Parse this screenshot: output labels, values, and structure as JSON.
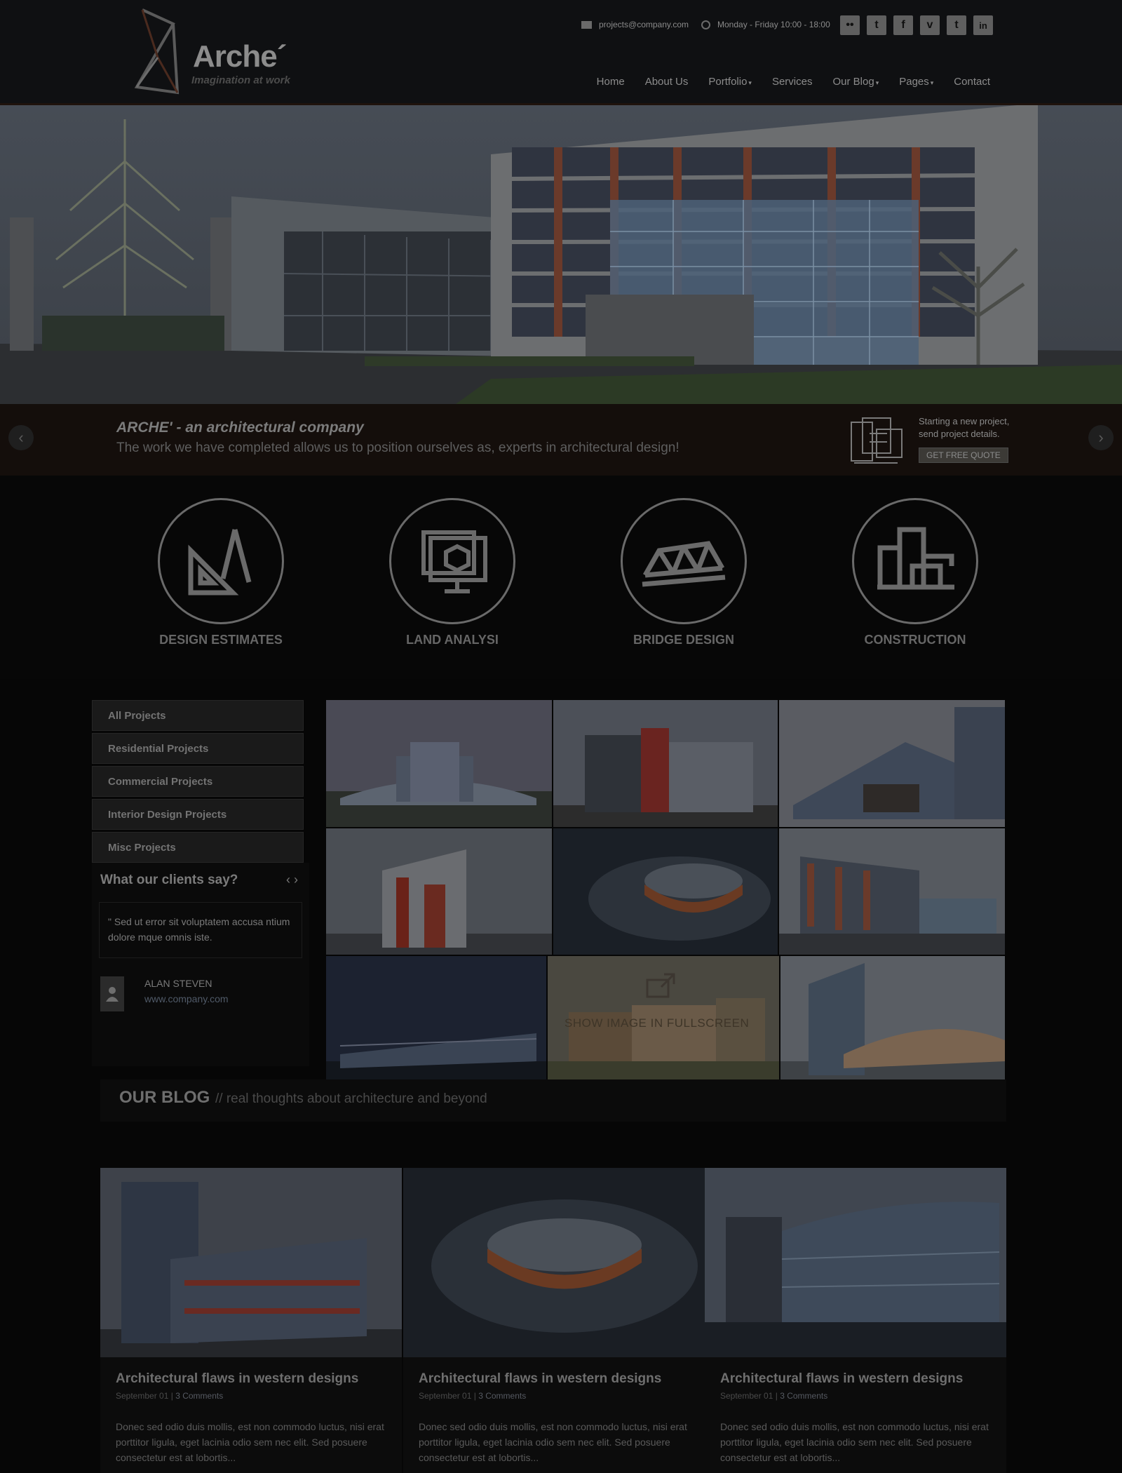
{
  "header": {
    "logo_word": "Arche´",
    "logo_tagline": "Imagination at work",
    "email": "projects@company.com",
    "hours": "Monday - Friday 10:00 - 18:00",
    "social": [
      {
        "icon": "flickr-icon",
        "glyph": "••"
      },
      {
        "icon": "twitter-icon",
        "glyph": "t"
      },
      {
        "icon": "facebook-icon",
        "glyph": "f"
      },
      {
        "icon": "vimeo-icon",
        "glyph": "v"
      },
      {
        "icon": "tumblr-icon",
        "glyph": "t"
      },
      {
        "icon": "linkedin-icon",
        "glyph": "in"
      }
    ],
    "nav": [
      "Home",
      "About Us",
      "Portfolio",
      "Services",
      "Our Blog",
      "Pages",
      "Contact"
    ]
  },
  "banner": {
    "title": "ARCHE' - an architectural company",
    "subtitle": "The work we have completed allows us to position ourselves as, experts in architectural design!",
    "quote_text_1": "Starting a new project,",
    "quote_text_2": "send project details.",
    "quote_button": "GET FREE QUOTE",
    "prev_arrow": "‹",
    "next_arrow": "›"
  },
  "services": [
    {
      "label": "DESIGN ESTIMATES",
      "icon": "set-square-compass-icon"
    },
    {
      "label": "LAND ANALYSI",
      "icon": "monitor-cube-icon"
    },
    {
      "label": "BRIDGE DESIGN",
      "icon": "bridge-icon"
    },
    {
      "label": "CONSTRUCTION",
      "icon": "buildings-icon"
    }
  ],
  "categories": [
    "All Projects",
    "Residential Projects",
    "Commercial Projects",
    "Interior Design Projects",
    "Misc Projects"
  ],
  "testimonial": {
    "title": "What our clients say?",
    "nav": "‹  ›",
    "quote": "\" Sed ut error sit voluptatem accusa ntium dolore mque omnis iste.",
    "name": "ALAN STEVEN",
    "site": "www.company.com"
  },
  "gallery": {
    "overlay_text": "SHOW IMAGE IN FULLSCREEN"
  },
  "blog": {
    "heading": "OUR BLOG",
    "subheading": "// real thoughts about architecture and beyond",
    "posts": [
      {
        "title": "Architectural flaws in western designs",
        "date": "September 01",
        "comments": "3 Comments",
        "excerpt": "Donec sed odio duis mollis, est non commodo luctus, nisi erat porttitor ligula, eget lacinia odio sem nec elit. Sed posuere consectetur est at lobortis..."
      },
      {
        "title": "Architectural flaws in western designs",
        "date": "September 01",
        "comments": "3 Comments",
        "excerpt": "Donec sed odio duis mollis, est non commodo luctus, nisi erat porttitor ligula, eget lacinia odio sem nec elit. Sed posuere consectetur est at lobortis..."
      },
      {
        "title": "Architectural flaws in western designs",
        "date": "September 01",
        "comments": "3 Comments",
        "excerpt": "Donec sed odio duis mollis, est non commodo luctus, nisi erat porttitor ligula, eget lacinia odio sem nec elit. Sed posuere consectetur est at lobortis..."
      }
    ]
  }
}
